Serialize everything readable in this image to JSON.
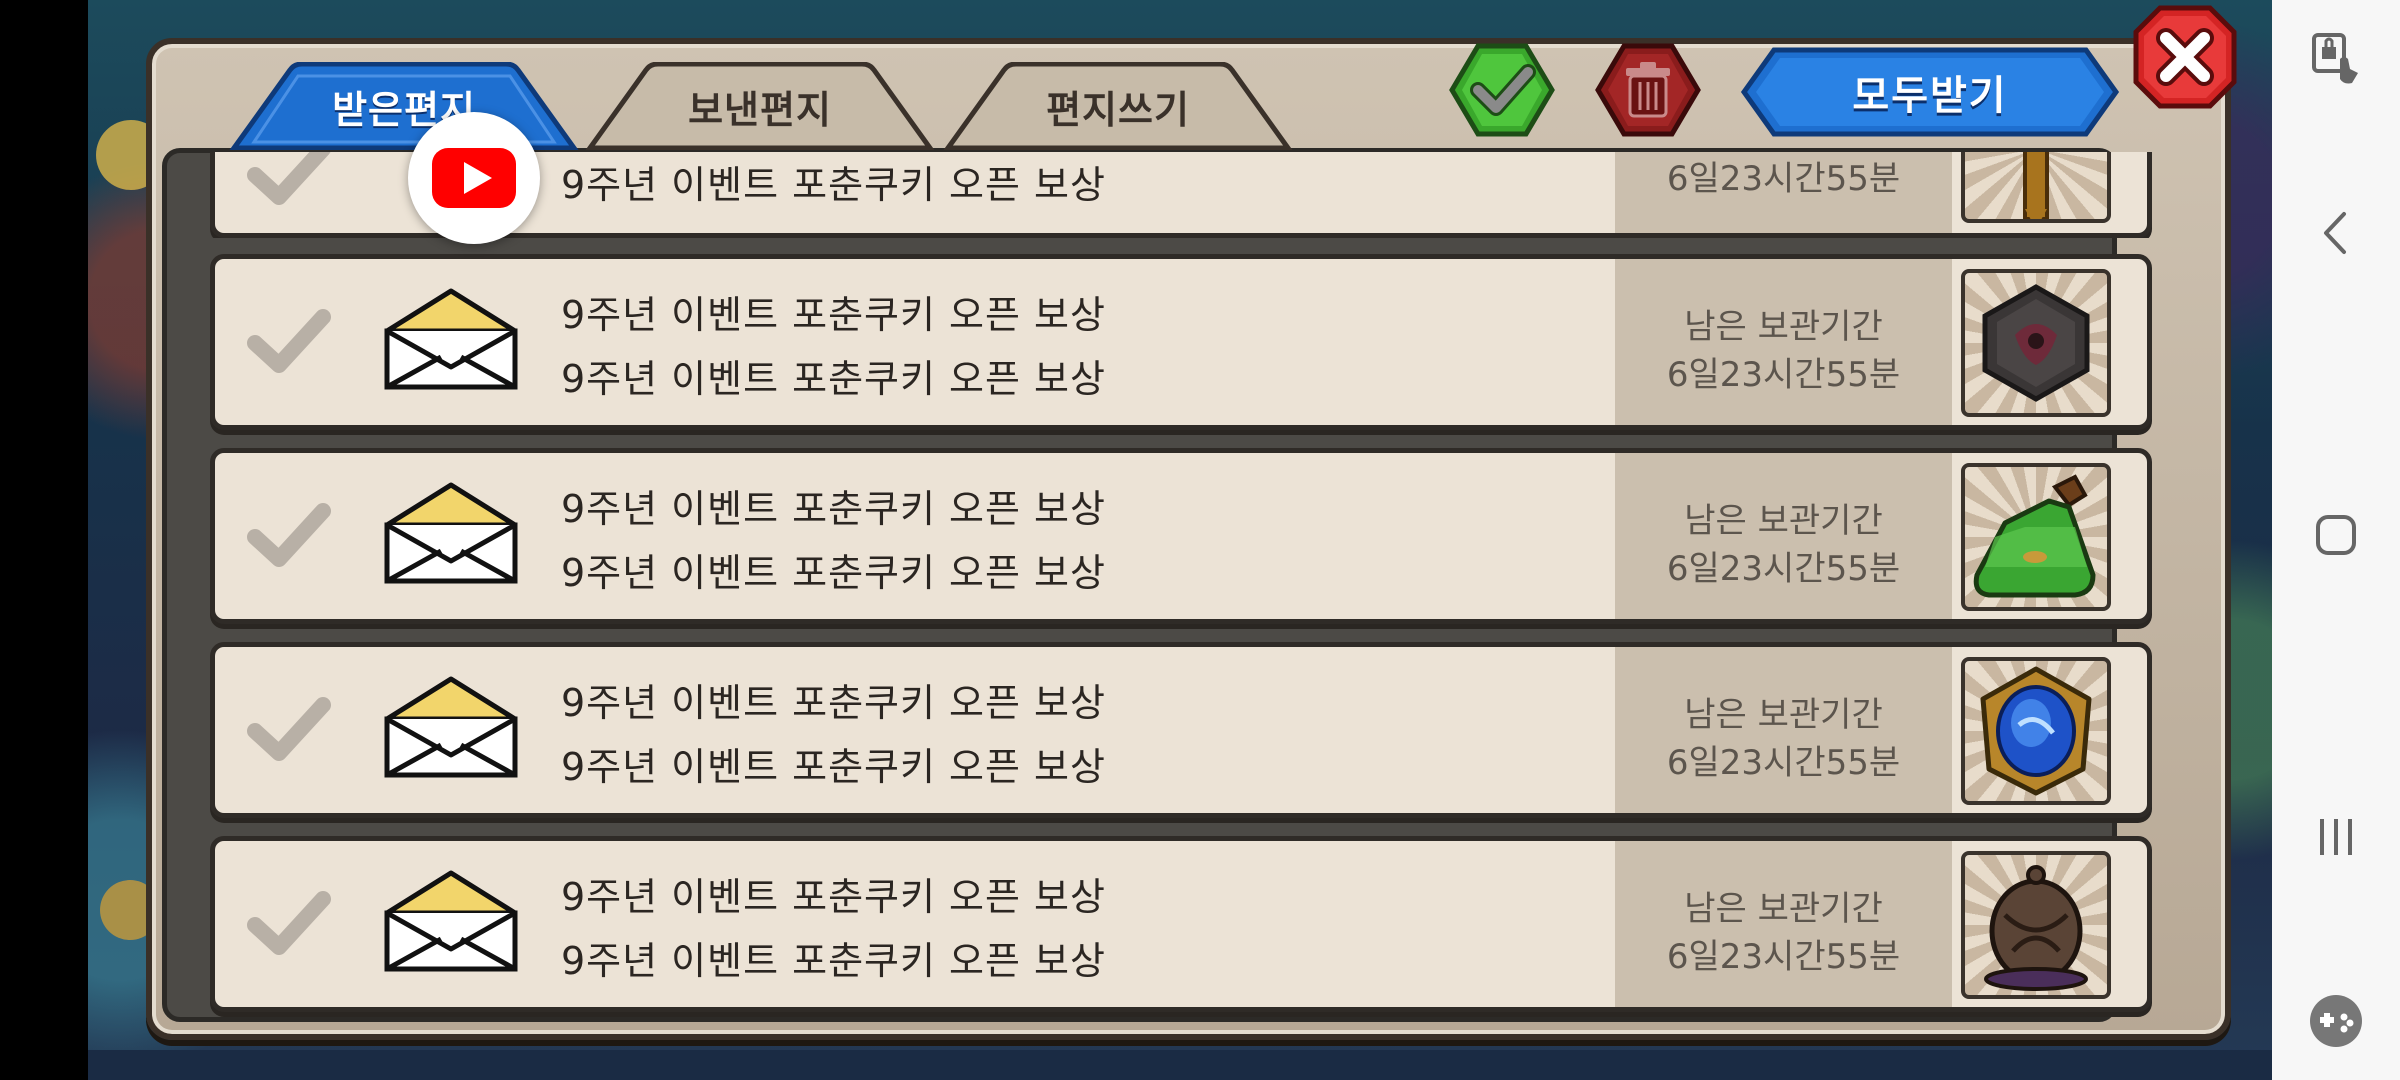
{
  "tabs": {
    "inbox": "받은편지",
    "sent": "보낸편지",
    "write": "편지쓰기"
  },
  "actions": {
    "receive_all": "모두받기",
    "select_all_icon": "check-icon",
    "delete_icon": "trash-icon",
    "close_icon": "close-icon"
  },
  "mails": [
    {
      "line1": "",
      "line2": "9주년 이벤트 포춘쿠키 오픈 보상",
      "expiry_label": "",
      "expiry_time": "6일23시간55분",
      "reward_icon": "sword-reward-icon"
    },
    {
      "line1": "9주년 이벤트 포춘쿠키 오픈 보상",
      "line2": "9주년 이벤트 포춘쿠키 오픈 보상",
      "expiry_label": "남은 보관기간",
      "expiry_time": "6일23시간55분",
      "reward_icon": "dark-emblem-reward-icon"
    },
    {
      "line1": "9주년 이벤트 포춘쿠키 오픈 보상",
      "line2": "9주년 이벤트 포춘쿠키 오픈 보상",
      "expiry_label": "남은 보관기간",
      "expiry_time": "6일23시간55분",
      "reward_icon": "green-potion-reward-icon"
    },
    {
      "line1": "9주년 이벤트 포춘쿠키 오픈 보상",
      "line2": "9주년 이벤트 포춘쿠키 오픈 보상",
      "expiry_label": "남은 보관기간",
      "expiry_time": "6일23시간55분",
      "reward_icon": "blue-gem-badge-reward-icon"
    },
    {
      "line1": "9주년 이벤트 포춘쿠키 오픈 보상",
      "line2": "9주년 이벤트 포춘쿠키 오픈 보상",
      "expiry_label": "남은 보관기간",
      "expiry_time": "6일23시간55분",
      "reward_icon": "creature-egg-reward-icon"
    }
  ],
  "overlay": {
    "icon": "youtube-icon"
  },
  "system_nav": {
    "icons": [
      "touch-lock-icon",
      "back-icon",
      "home-icon",
      "recents-icon",
      "game-tools-icon"
    ]
  },
  "colors": {
    "tab_active": "#1e6fd0",
    "tab_inactive": "#c7bba9",
    "confirm_green": "#3aa82c",
    "delete_red": "#8a1c1c",
    "close_red": "#d42424",
    "row_bg": "#ece3d6",
    "expiry_bg": "#cbbfae"
  }
}
